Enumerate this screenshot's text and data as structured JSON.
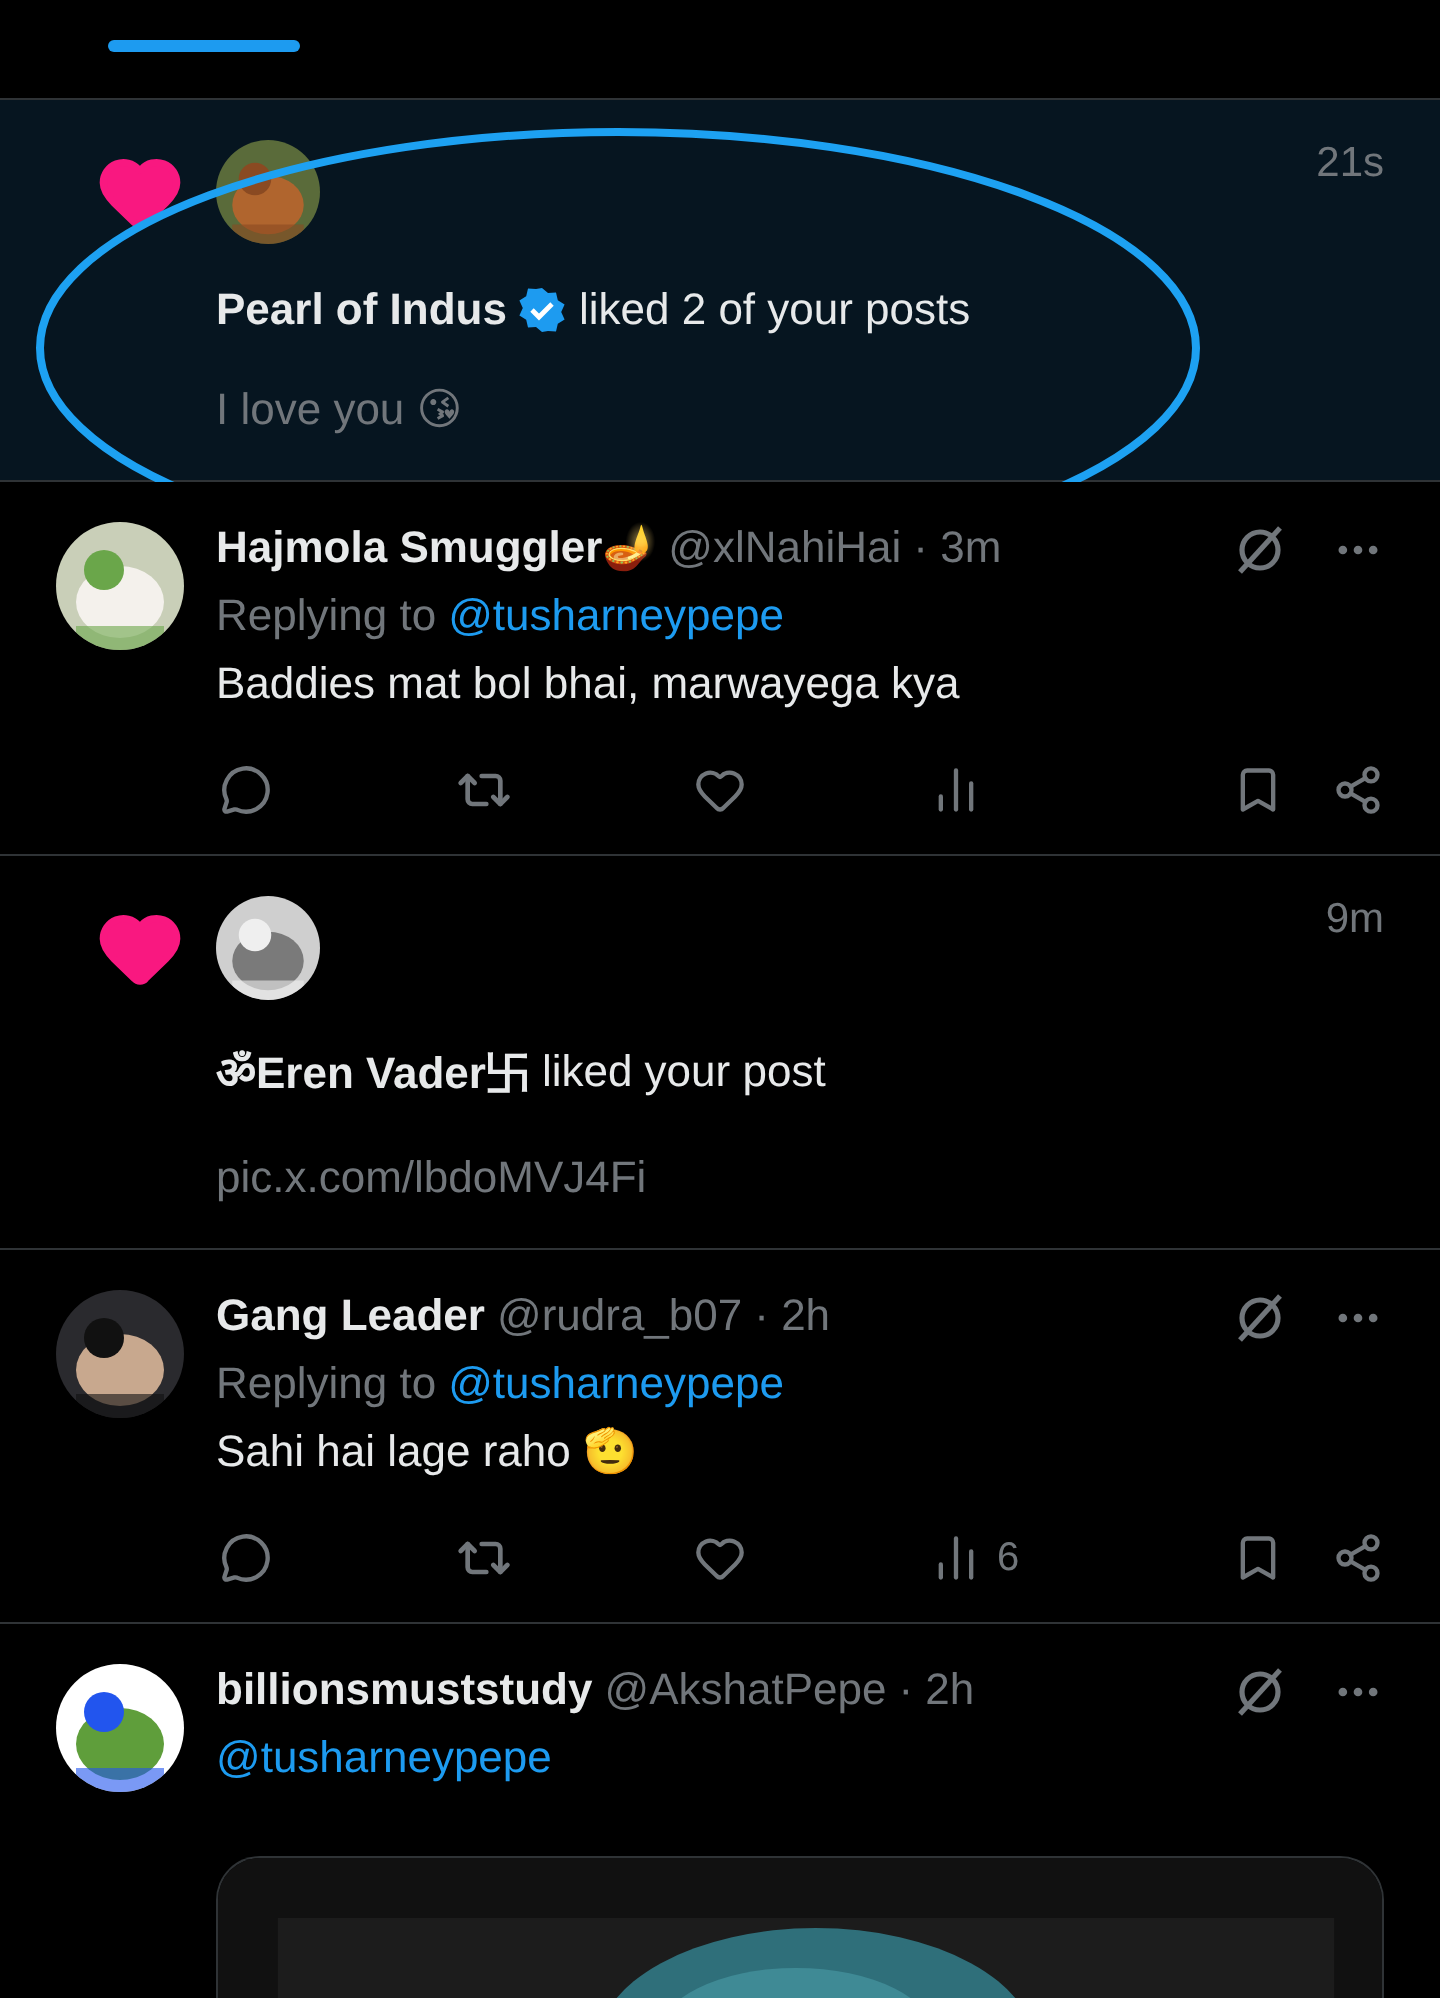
{
  "items": [
    {
      "kind": "like",
      "unread": true,
      "highlighted": true,
      "user": "Pearl of Indus",
      "verified": true,
      "action": "liked 2 of your posts",
      "time": "21s",
      "preview": "I love you 😘"
    },
    {
      "kind": "reply",
      "name": "Hajmola Smuggler🪔",
      "handle": "@xlNahiHai",
      "time": "· 3m",
      "replying_prefix": "Replying to",
      "mention": "@tusharneypepe",
      "text": "Baddies mat bol bhai, marwayega kya"
    },
    {
      "kind": "like",
      "unread": false,
      "highlighted": false,
      "user": "ॐEren Vader卐",
      "verified": false,
      "action": "liked your post",
      "time": "9m",
      "preview": "pic.x.com/lbdoMVJ4Fi"
    },
    {
      "kind": "reply",
      "name": "Gang Leader",
      "handle": "@rudra_b07",
      "time": "· 2h",
      "replying_prefix": "Replying to",
      "mention": "@tusharneypepe",
      "text": "Sahi hai lage raho 🫡",
      "views": "6"
    },
    {
      "kind": "mention",
      "name": "billionsmuststudy",
      "handle": "@AkshatPepe",
      "time": "· 2h",
      "mention": "@tusharneypepe",
      "media": true
    }
  ]
}
